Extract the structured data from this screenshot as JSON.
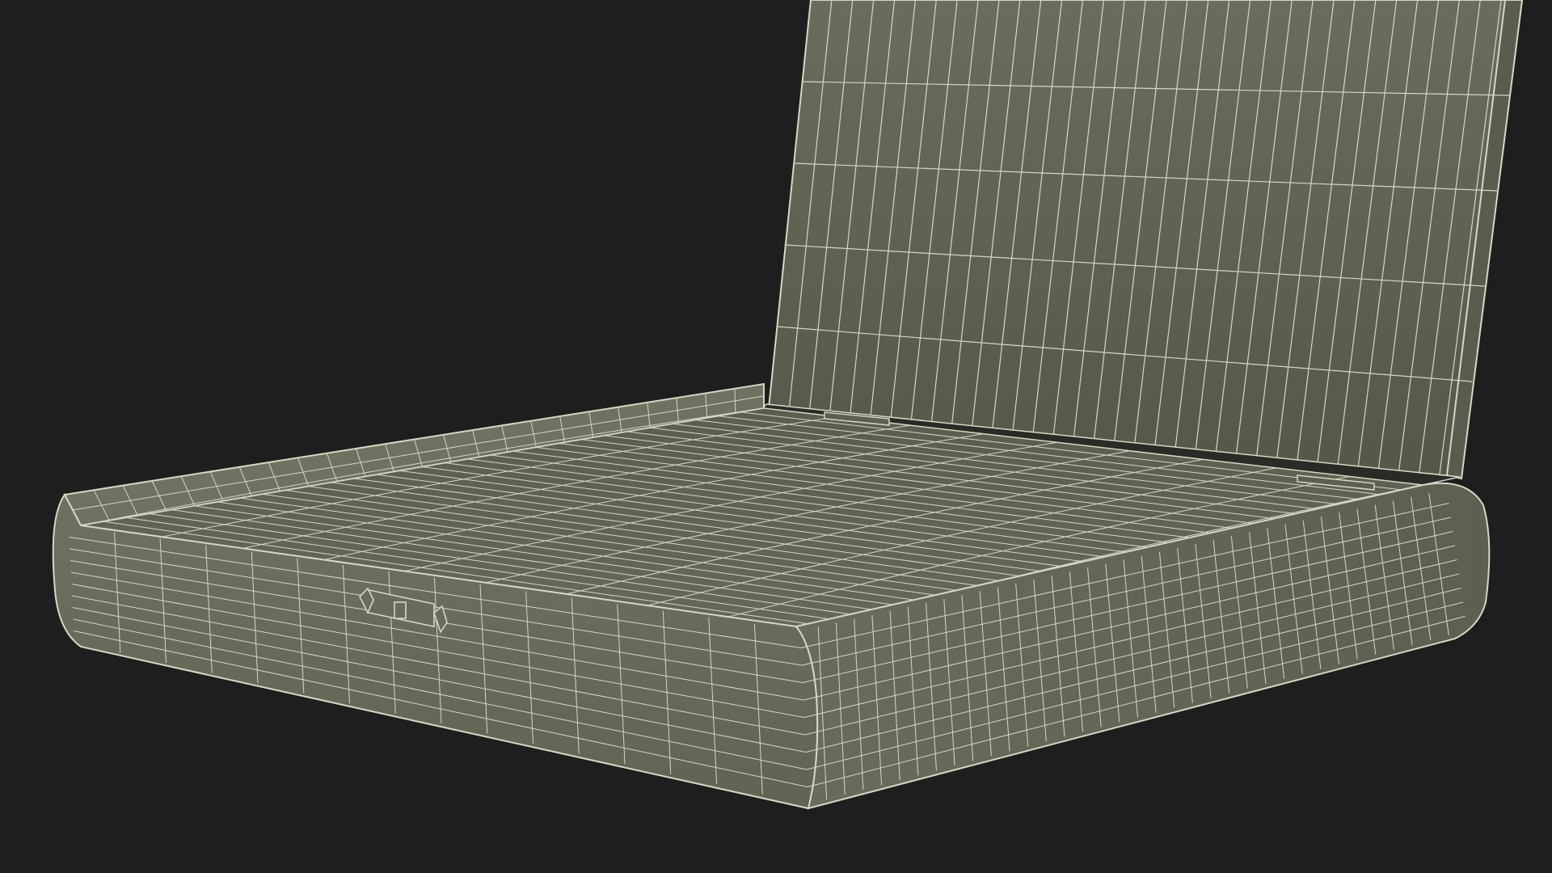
{
  "scene": {
    "background_color": "#1e1e1e",
    "wire_color": "#d8d6c4",
    "surface_color_light": "#6e6f5f",
    "surface_color_mid": "#606252",
    "surface_color_dark": "#4f5143",
    "subject": "wireframe-3d-model-open-cigar-box"
  }
}
